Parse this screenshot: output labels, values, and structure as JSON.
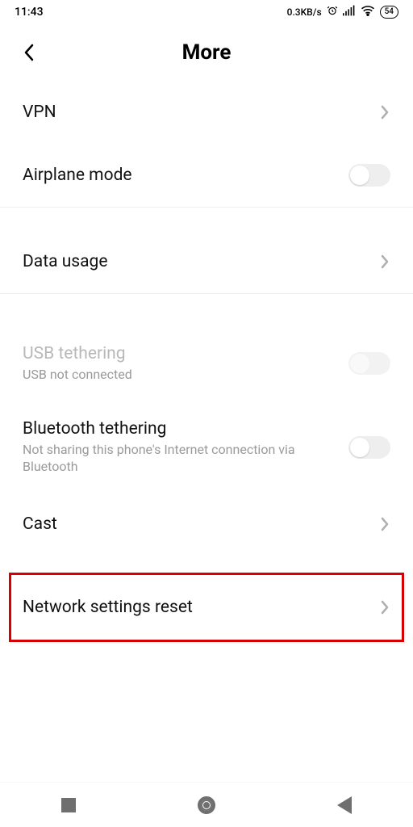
{
  "status": {
    "time": "11:43",
    "speed": "0.3KB/s",
    "battery": "54"
  },
  "header": {
    "title": "More"
  },
  "items": {
    "vpn": {
      "label": "VPN"
    },
    "airplane": {
      "label": "Airplane mode"
    },
    "data_usage": {
      "label": "Data usage"
    },
    "usb_tether": {
      "label": "USB tethering",
      "sub": "USB not connected"
    },
    "bt_tether": {
      "label": "Bluetooth tethering",
      "sub": "Not sharing this phone's Internet connection via Bluetooth"
    },
    "cast": {
      "label": "Cast"
    },
    "network_reset": {
      "label": "Network settings reset"
    }
  }
}
